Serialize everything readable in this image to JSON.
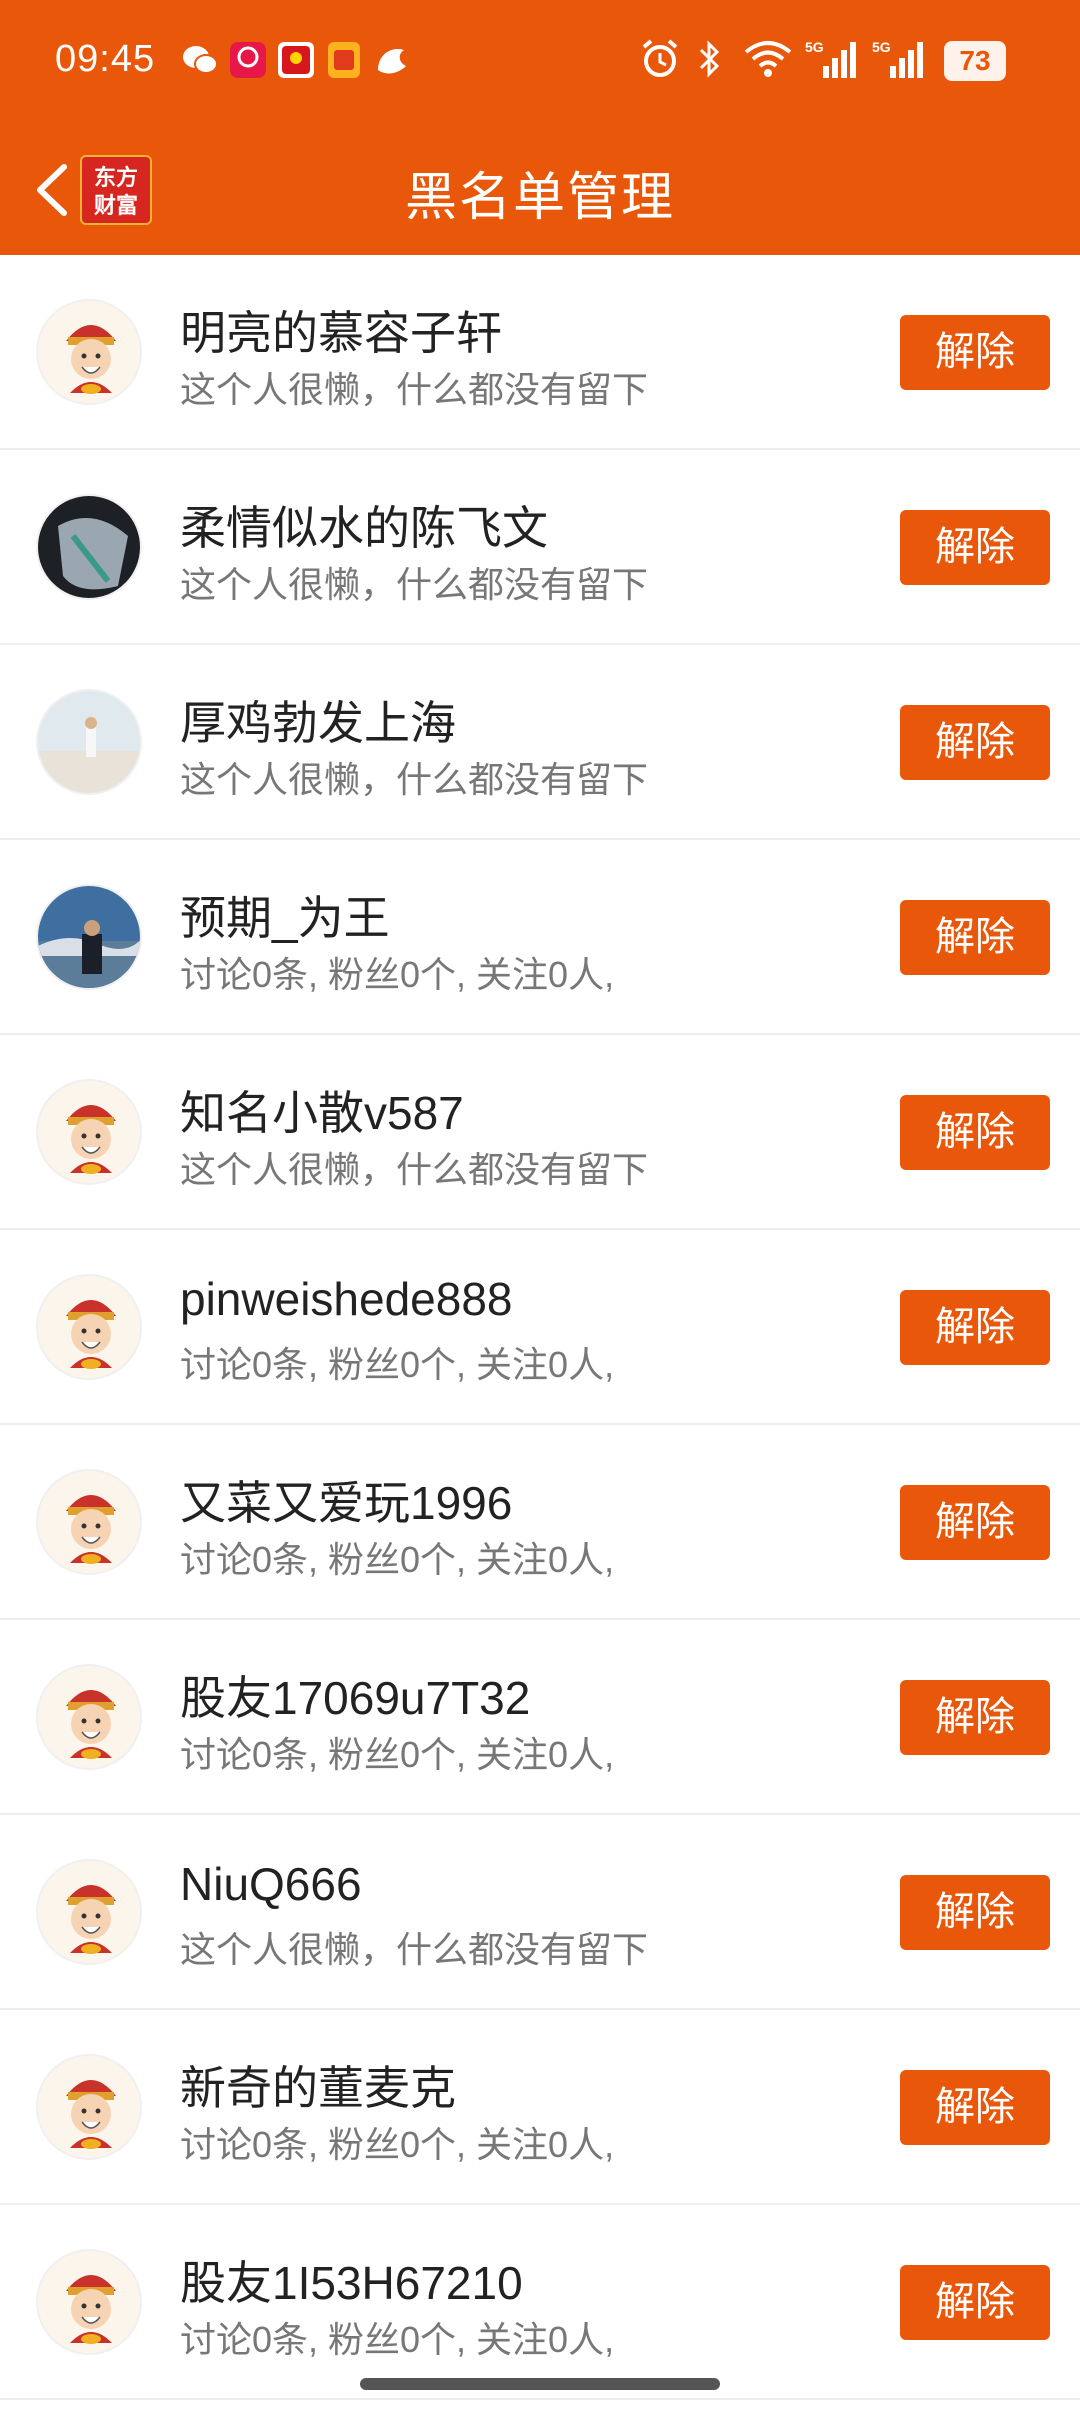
{
  "status_bar": {
    "time": "09:45",
    "battery": "73",
    "network": "5G"
  },
  "header": {
    "title": "黑名单管理",
    "logo_line1": "东方",
    "logo_line2": "财富"
  },
  "colors": {
    "accent": "#E9580A"
  },
  "list": {
    "items": [
      {
        "name": "明亮的慕容子轩",
        "desc": "这个人很懒，什么都没有留下",
        "button": "解除",
        "avatar": "mascot"
      },
      {
        "name": "柔情似水的陈飞文",
        "desc": "这个人很懒，什么都没有留下",
        "button": "解除",
        "avatar": "photo-dark"
      },
      {
        "name": "厚鸡勃发上海",
        "desc": "这个人很懒，什么都没有留下",
        "button": "解除",
        "avatar": "photo-beach"
      },
      {
        "name": "预期_为王",
        "desc": "讨论0条, 粉丝0个, 关注0人,",
        "button": "解除",
        "avatar": "photo-person"
      },
      {
        "name": "知名小散v587",
        "desc": "这个人很懒，什么都没有留下",
        "button": "解除",
        "avatar": "mascot"
      },
      {
        "name": "pinweishede888",
        "desc": "讨论0条, 粉丝0个, 关注0人,",
        "button": "解除",
        "avatar": "mascot"
      },
      {
        "name": "又菜又爱玩1996",
        "desc": "讨论0条, 粉丝0个, 关注0人,",
        "button": "解除",
        "avatar": "mascot"
      },
      {
        "name": "股友17069u7T32",
        "desc": "讨论0条, 粉丝0个, 关注0人,",
        "button": "解除",
        "avatar": "mascot"
      },
      {
        "name": "NiuQ666",
        "desc": "这个人很懒，什么都没有留下",
        "button": "解除",
        "avatar": "mascot"
      },
      {
        "name": "新奇的董麦克",
        "desc": "讨论0条, 粉丝0个, 关注0人,",
        "button": "解除",
        "avatar": "mascot"
      },
      {
        "name": "股友1I53H67210",
        "desc": "讨论0条, 粉丝0个, 关注0人,",
        "button": "解除",
        "avatar": "mascot"
      }
    ]
  }
}
